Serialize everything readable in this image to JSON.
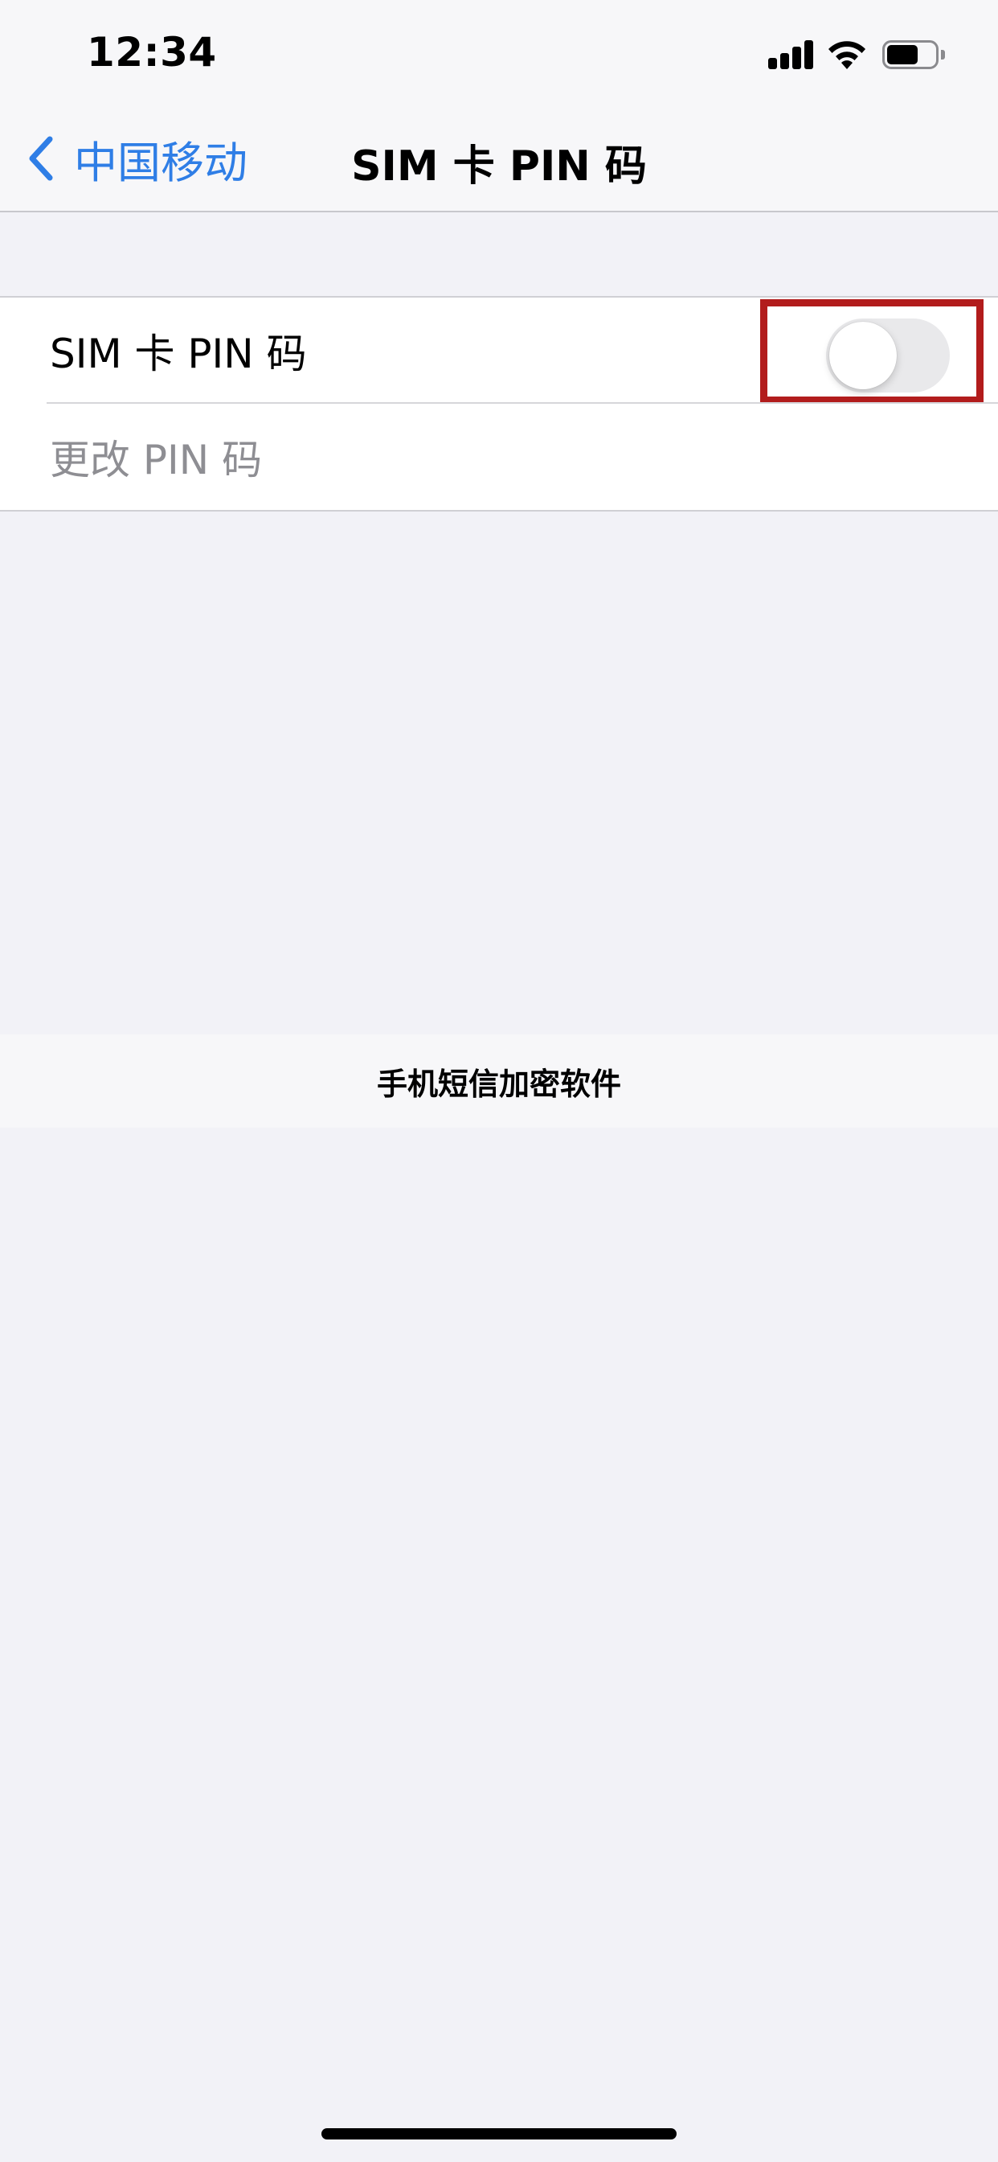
{
  "status_bar": {
    "time": "12:34",
    "icons": [
      "signal-icon",
      "wifi-icon",
      "battery-icon"
    ]
  },
  "nav": {
    "back_label": "中国移动",
    "back_icon": "chevron-left-icon",
    "title": "SIM 卡 PIN 码"
  },
  "settings": {
    "sim_pin_label": "SIM 卡 PIN 码",
    "sim_pin_enabled": false,
    "change_pin_label": "更改 PIN 码"
  },
  "banner": {
    "text": "手机短信加密软件"
  },
  "colors": {
    "accent": "#2f7ee6",
    "highlight": "#b21c1c",
    "background": "#f2f2f7"
  }
}
